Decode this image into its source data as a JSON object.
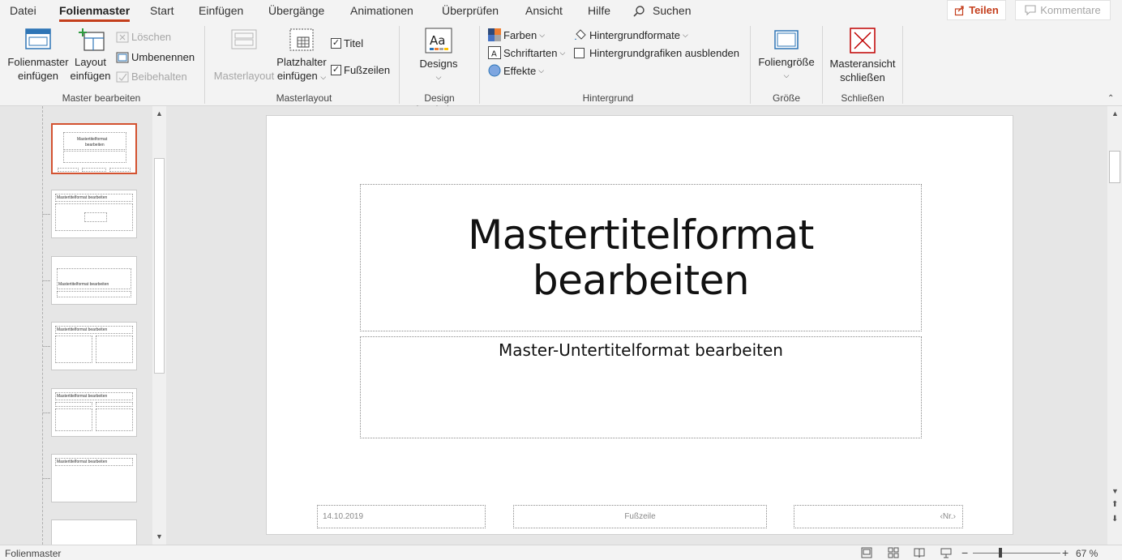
{
  "tabs": [
    "Datei",
    "Folienmaster",
    "Start",
    "Einfügen",
    "Übergänge",
    "Animationen",
    "Überprüfen",
    "Ansicht",
    "Hilfe"
  ],
  "search_label": "Suchen",
  "share_label": "Teilen",
  "comments_label": "Kommentare",
  "ribbon": {
    "master_edit": {
      "insert_master_1": "Folienmaster",
      "insert_master_2": "einfügen",
      "insert_layout_1": "Layout",
      "insert_layout_2": "einfügen",
      "delete": "Löschen",
      "rename": "Umbenennen",
      "preserve": "Beibehalten",
      "group_label": "Master bearbeiten"
    },
    "master_layout": {
      "master_layout": "Masterlayout",
      "placeholder_1": "Platzhalter",
      "placeholder_2": "einfügen",
      "title_check": "Titel",
      "footer_check": "Fußzeilen",
      "group_label": "Masterlayout"
    },
    "design": {
      "designs": "Designs",
      "group_label": "Design bearbeiten"
    },
    "background": {
      "colors": "Farben",
      "fonts": "Schriftarten",
      "effects": "Effekte",
      "bg_styles": "Hintergrundformate",
      "hide_bg": "Hintergrundgrafiken ausblenden",
      "group_label": "Hintergrund"
    },
    "size": {
      "slide_size": "Foliengröße",
      "group_label": "Größe"
    },
    "close": {
      "close_1": "Masteransicht",
      "close_2": "schließen",
      "group_label": "Schließen"
    }
  },
  "thumbnails": {
    "t1_title_1": "Mastertitelformat",
    "t1_title_2": "bearbeiten",
    "t2_title": "Mastertitelformat bearbeiten",
    "t3_title": "Mastertitelformat bearbeiten",
    "t4_title": "Mastertitelformat bearbeiten",
    "t5_title": "Mastertitelformat bearbeiten",
    "t6_title": "Mastertitelformat bearbeiten"
  },
  "slide": {
    "title_1": "Mastertitelformat",
    "title_2": "bearbeiten",
    "subtitle": "Master-Untertitelformat bearbeiten",
    "date": "14.10.2019",
    "footer": "Fußzeile",
    "number": "‹Nr.›"
  },
  "status": {
    "view_name": "Folienmaster",
    "zoom": "67 %"
  },
  "colors": {
    "accent": "#c43e1c",
    "selected_thumb": "#d35230"
  }
}
